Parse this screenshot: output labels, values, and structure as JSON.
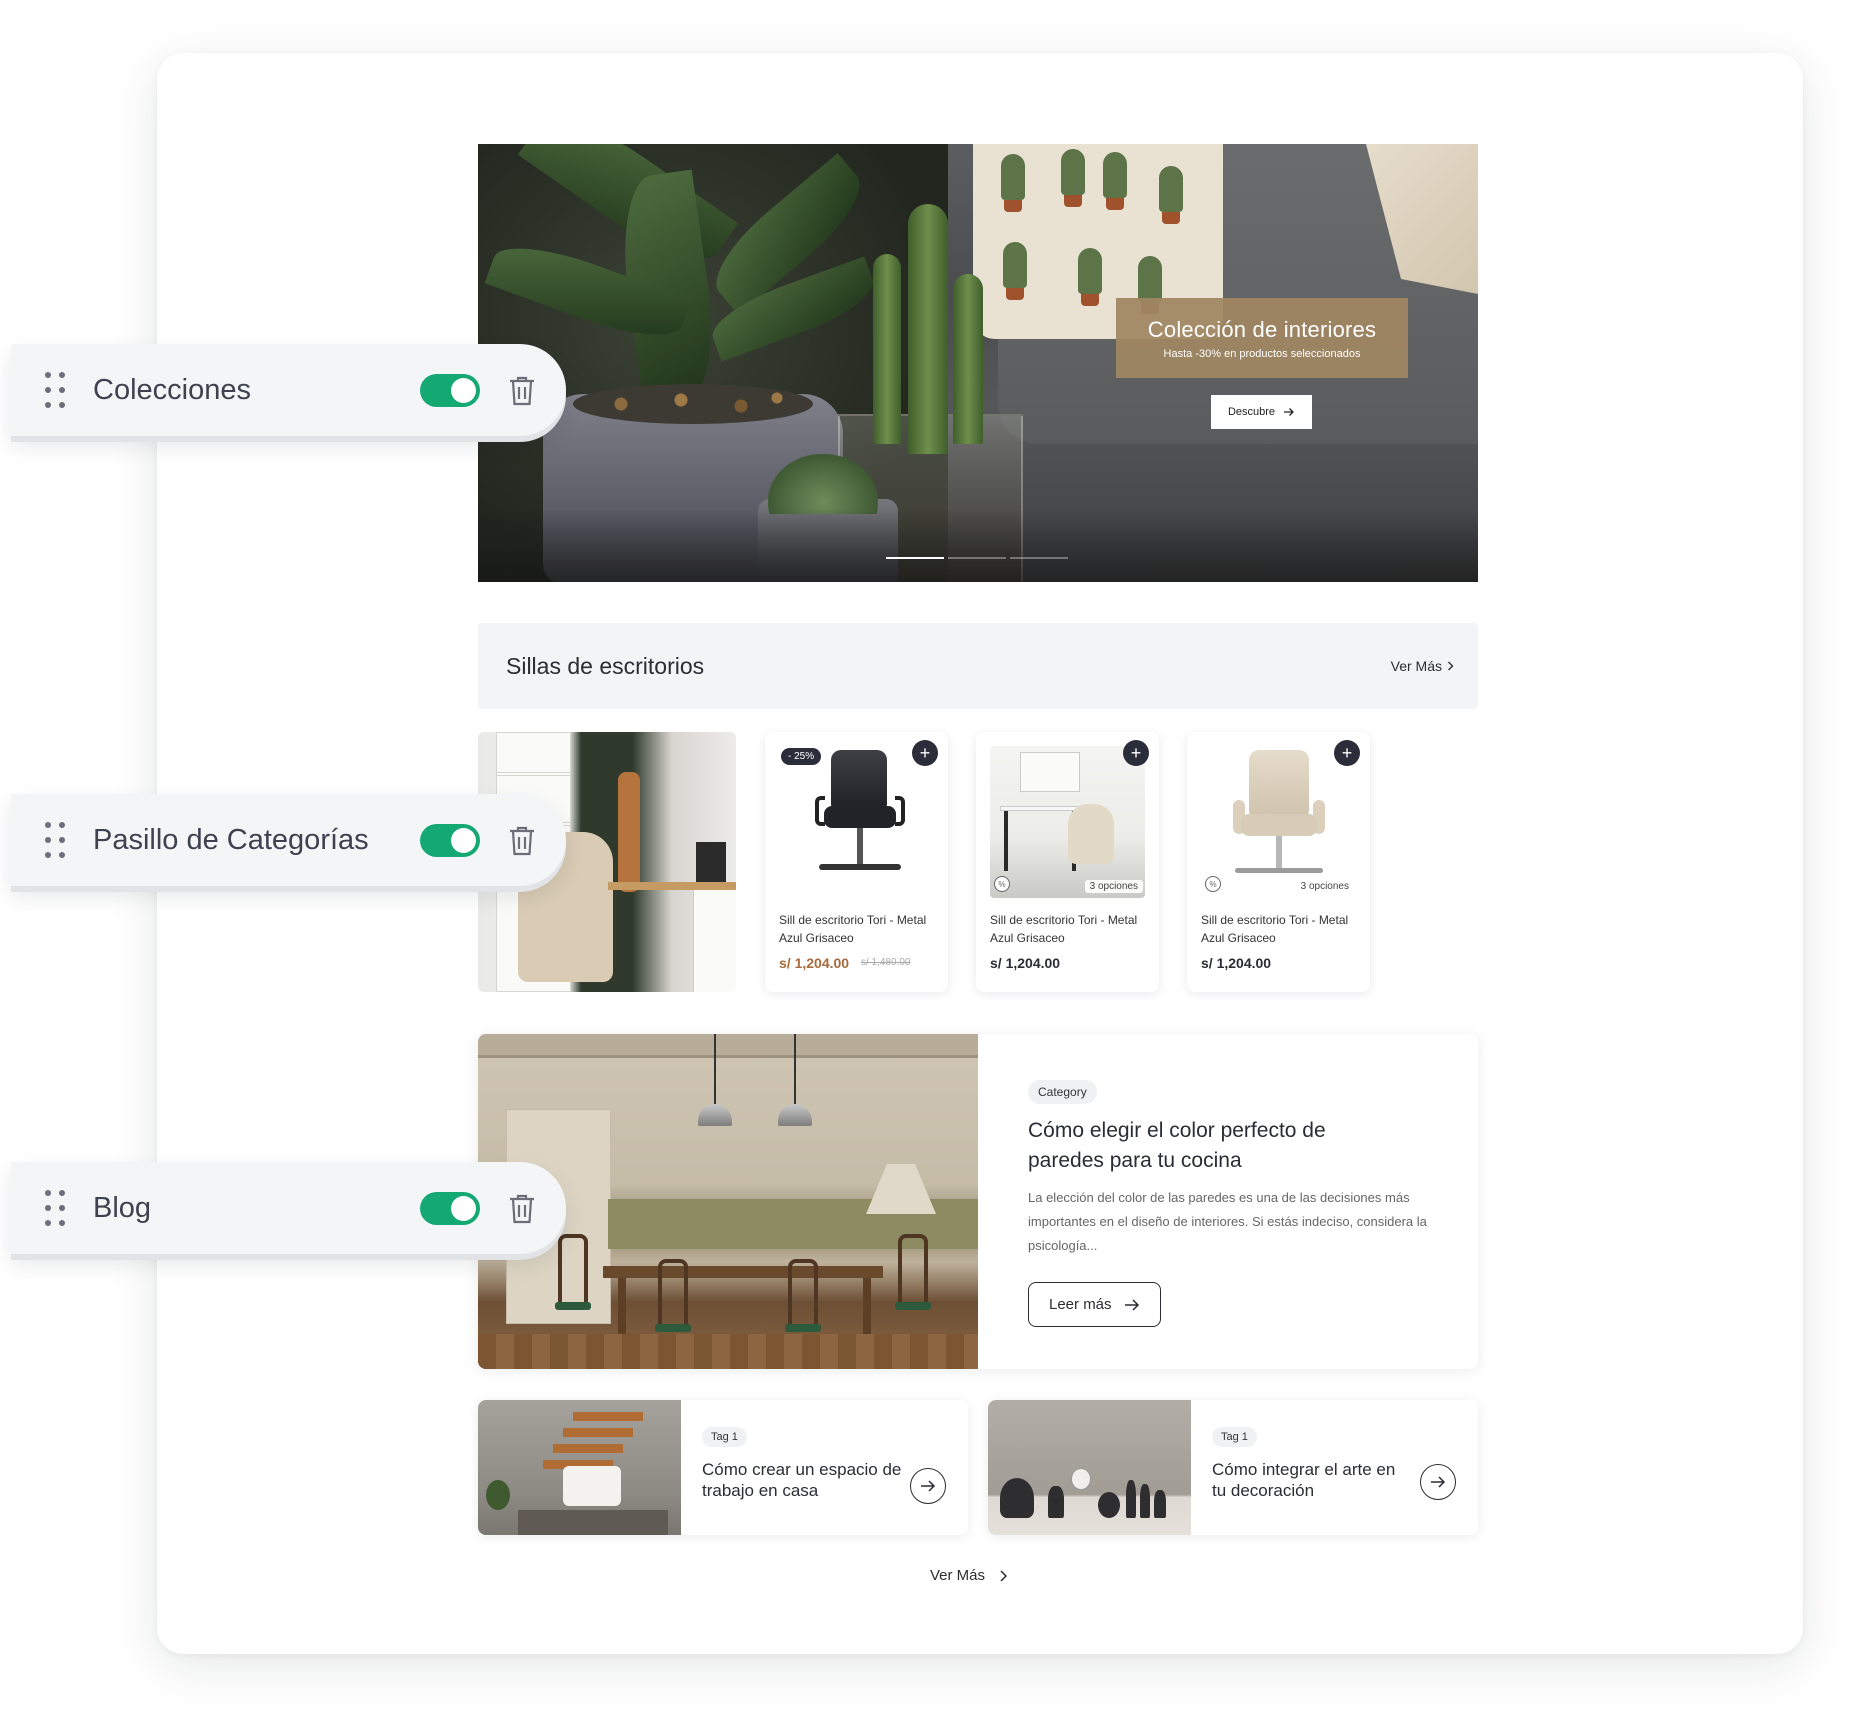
{
  "hero": {
    "promo_title": "Colección de interiores",
    "promo_subtitle": "Hasta -30% en productos seleccionados",
    "cta_label": "Descubre",
    "slides": 3,
    "active_slide": 1
  },
  "products_section": {
    "title": "Sillas de escritorios",
    "more_label": "Ver Más",
    "products": [
      {
        "badge": "- 25%",
        "name": "Sill de escritorio Tori - Metal Azul Grisaceo",
        "price": "s/ 1,204.00",
        "old_price": "s/ 1,480.00",
        "options": ""
      },
      {
        "badge": "",
        "name": "Sill de escritorio Tori - Metal Azul Grisaceo",
        "price": "s/ 1,204.00",
        "old_price": "",
        "options": "3 opciones"
      },
      {
        "badge": "",
        "name": "Sill de escritorio Tori - Metal Azul Grisaceo",
        "price": "s/ 1,204.00",
        "old_price": "",
        "options": "3 opciones"
      }
    ]
  },
  "blog": {
    "feature": {
      "category": "Category",
      "title": "Cómo elegir el color perfecto de paredes para tu cocina",
      "excerpt": "La elección del color de las paredes es una de las decisiones más importantes en el diseño de interiores. Si estás indeciso, considera la psicología...",
      "read_more": "Leer más"
    },
    "posts": [
      {
        "tag": "Tag 1",
        "title": "Cómo crear un espacio de trabajo en casa"
      },
      {
        "tag": "Tag 1",
        "title": "Cómo integrar el arte en tu decoración"
      }
    ],
    "more_label": "Ver Más"
  },
  "controls": [
    {
      "label": "Colecciones",
      "enabled": true
    },
    {
      "label": "Pasillo de Categorías",
      "enabled": true
    },
    {
      "label": "Blog",
      "enabled": true
    }
  ],
  "colors": {
    "toggle_on": "#14a873",
    "promo_bg": "#a08762",
    "dark_button": "#2b2d3a",
    "sale_price": "#a86a3b"
  }
}
